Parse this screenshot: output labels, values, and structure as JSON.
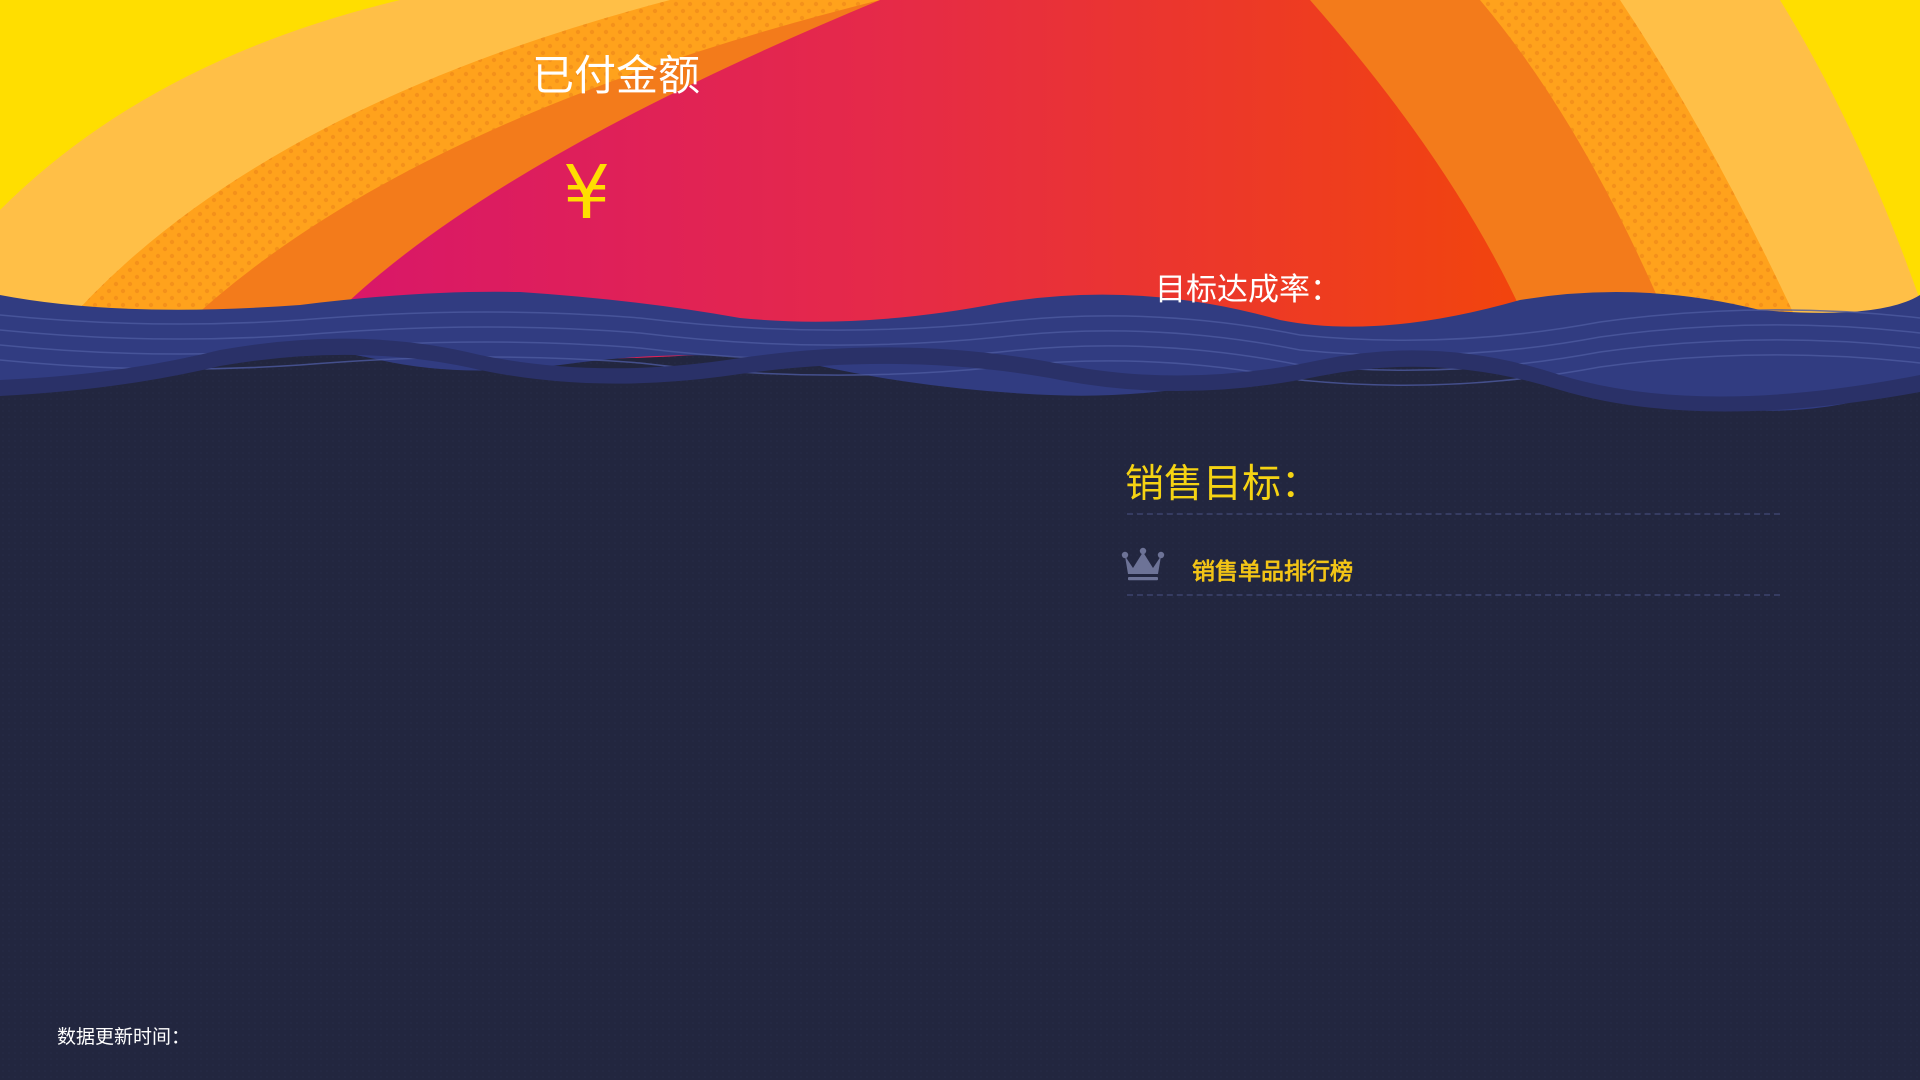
{
  "header": {
    "paid_amount_label": "已付金额",
    "currency_symbol": "¥",
    "target_rate_label": "目标达成率："
  },
  "sales": {
    "target_label": "销售目标：",
    "ranking_title": "销售单品排行榜"
  },
  "footer": {
    "update_time_label": "数据更新时间："
  },
  "colors": {
    "background": "#22263f",
    "wave": "#313c81",
    "accent_yellow": "#ffde00",
    "sun_magenta": "#d8166a",
    "sun_orange": "#f2450c"
  },
  "icons": {
    "ranking": "crown-icon"
  }
}
